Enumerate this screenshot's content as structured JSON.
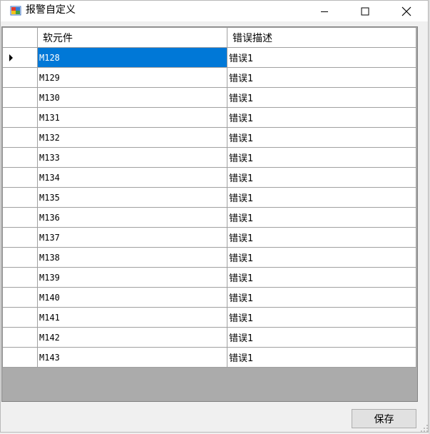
{
  "window": {
    "title": "报警自定义"
  },
  "grid": {
    "columns": [
      "软元件",
      "错误描述"
    ],
    "rows": [
      {
        "device": "M128",
        "desc": "错误1",
        "selected": true
      },
      {
        "device": "M129",
        "desc": "错误1"
      },
      {
        "device": "M130",
        "desc": "错误1"
      },
      {
        "device": "M131",
        "desc": "错误1"
      },
      {
        "device": "M132",
        "desc": "错误1"
      },
      {
        "device": "M133",
        "desc": "错误1"
      },
      {
        "device": "M134",
        "desc": "错误1"
      },
      {
        "device": "M135",
        "desc": "错误1"
      },
      {
        "device": "M136",
        "desc": "错误1"
      },
      {
        "device": "M137",
        "desc": "错误1"
      },
      {
        "device": "M138",
        "desc": "错误1"
      },
      {
        "device": "M139",
        "desc": "错误1"
      },
      {
        "device": "M140",
        "desc": "错误1"
      },
      {
        "device": "M141",
        "desc": "错误1"
      },
      {
        "device": "M142",
        "desc": "错误1"
      },
      {
        "device": "M143",
        "desc": "错误1"
      }
    ]
  },
  "footer": {
    "save_label": "保存"
  },
  "colors": {
    "selection": "#0078d7",
    "grid_background": "#ababab"
  }
}
